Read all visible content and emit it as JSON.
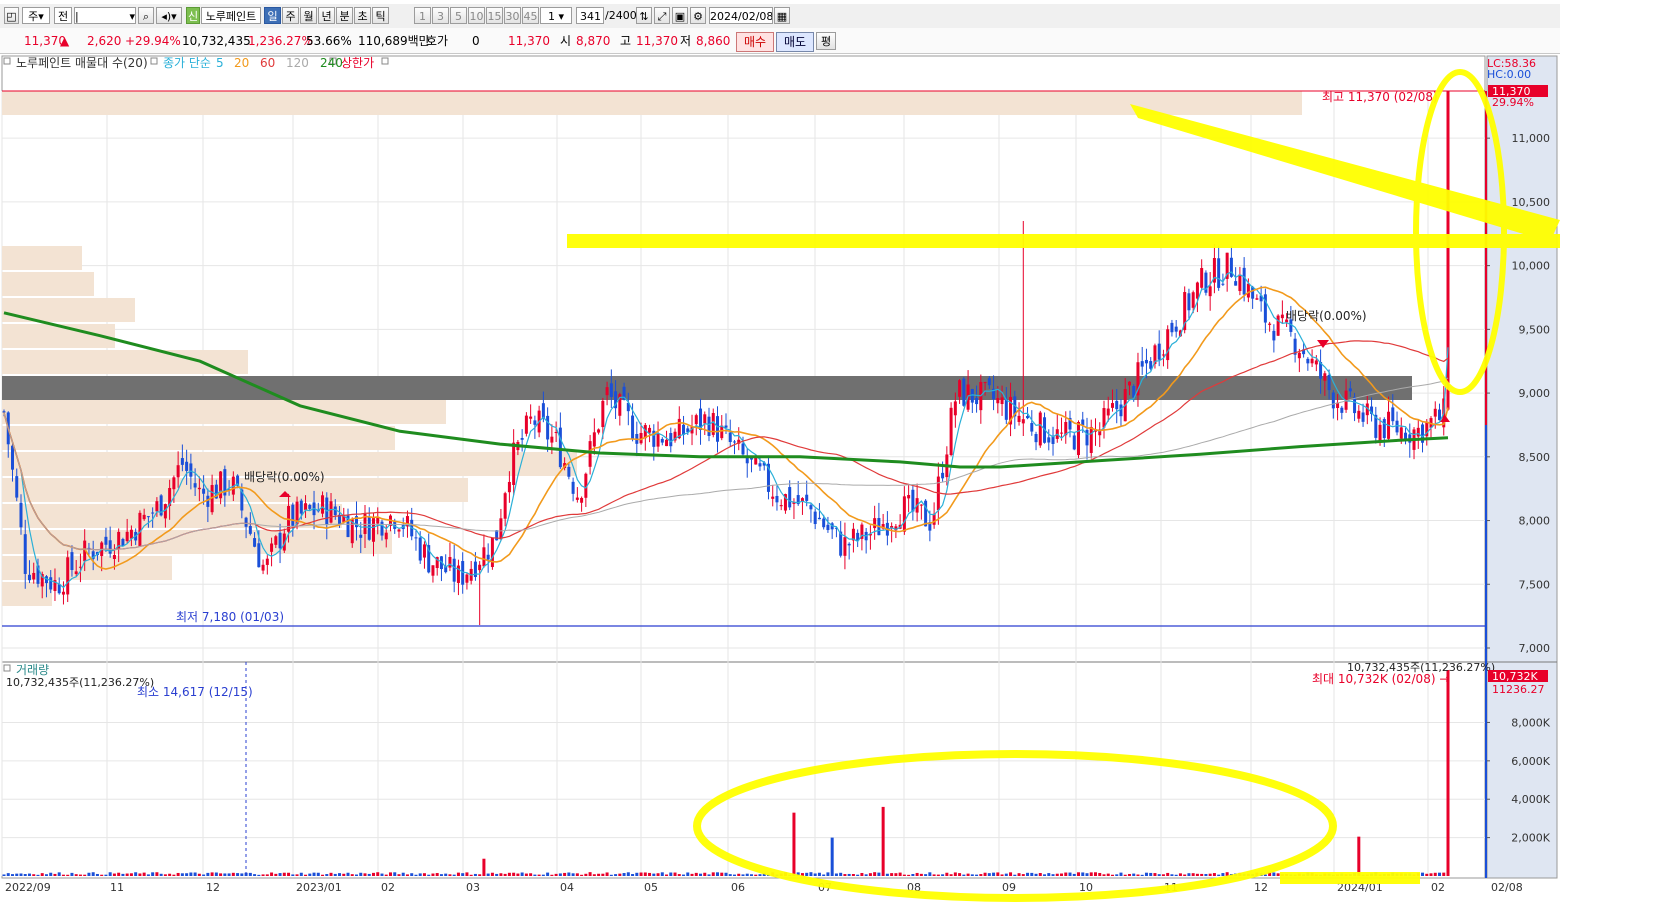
{
  "toolbar": {
    "market_select": "주",
    "scope_select": "전",
    "symbol_badge": "신",
    "stock_name": "노루페인트",
    "periods": [
      "일",
      "주",
      "월",
      "년",
      "분",
      "초",
      "틱"
    ],
    "active_period": "일",
    "intervals": [
      "1",
      "3",
      "5",
      "10",
      "15",
      "30",
      "45",
      "60"
    ],
    "step_value": "1",
    "count": "341",
    "count_total": "/2400",
    "date": "2024/02/08"
  },
  "quote": {
    "price": "11,370",
    "arrow": "▲",
    "change": "2,620",
    "change_rate": "+29.94%",
    "volume": "10,732,435",
    "volume_rate": "1,236.27%",
    "turnover": "53.66%",
    "amount": "110,689백만",
    "hoga_label": "호가",
    "hoga_value": "0",
    "hoga_price": "11,370",
    "open_label": "시",
    "open": "8,870",
    "high_label": "고",
    "high": "11,370",
    "low_label": "저",
    "low": "8,860",
    "buy_label": "매수",
    "sell_label": "매도",
    "avg_label": "평"
  },
  "price_panel": {
    "legend_title": "노루페인트 매물대 수(20)",
    "legend_ma_prefix": "종가 단순",
    "legend_limit": "상한가",
    "lc_label": "LC:58.36",
    "hc_label": "HC:0.00",
    "high_annotation": "최고 11,370 (02/08)",
    "low_annotation": "최저 7,180 (01/03)",
    "dividend_label": "배당락(0.00%)",
    "current_price_tag": "11,370",
    "current_rate_tag": "29.94%"
  },
  "volume_panel": {
    "title": "거래량",
    "current_info": "10,732,435주(11,236.27%)",
    "top_info": "10,732,435주(11,236.27%)",
    "max_annotation": "최대 10,732K (02/08) →",
    "min_annotation": "최소 14,617 (12/15)",
    "tag_value": "10,732K",
    "tag_rate": "11236.27"
  },
  "colors": {
    "up": "#e8002a",
    "down": "#1a4fd8",
    "ma5": "#2ab0d8",
    "ma20": "#f29a1c",
    "ma60": "#e03a3a",
    "ma120": "#aaaaaa",
    "ma240": "#1f8c1f",
    "volume_profile": "#f3e3d3",
    "highlighter": "#ffff00",
    "grey_band": "#707070"
  },
  "chart_data": [
    {
      "type": "candlestick",
      "title": "노루페인트",
      "x_tick_labels": [
        "2022/09",
        "11",
        "12",
        "2023/01",
        "02",
        "03",
        "04",
        "05",
        "06",
        "07",
        "08",
        "09",
        "10",
        "11",
        "12",
        "2024/01",
        "02",
        "02/08"
      ],
      "y_tick_labels": [
        "7,000",
        "7,500",
        "8,000",
        "8,500",
        "9,000",
        "9,500",
        "10,000",
        "10,500",
        "11,000"
      ],
      "ylim": [
        7000,
        11370
      ],
      "ma_periods": [
        5,
        20,
        60,
        120,
        240
      ],
      "series": [
        {
          "name": "종가",
          "points": [
            {
              "x": "2022/09",
              "y": 8800
            },
            {
              "x": "2022/10",
              "y": 7600
            },
            {
              "x": "2022/11",
              "y": 7800
            },
            {
              "x": "2022/12",
              "y": 8250
            },
            {
              "x": "2023/01",
              "y": 7900
            },
            {
              "x": "2023/02",
              "y": 8100
            },
            {
              "x": "2023/03",
              "y": 7700
            },
            {
              "x": "2023/04",
              "y": 7850
            },
            {
              "x": "2023/05",
              "y": 8400
            },
            {
              "x": "2023/06",
              "y": 8550
            },
            {
              "x": "2023/07",
              "y": 8300
            },
            {
              "x": "2023/08",
              "y": 8050
            },
            {
              "x": "2023/09",
              "y": 9050
            },
            {
              "x": "2023/10",
              "y": 8700
            },
            {
              "x": "2023/11",
              "y": 9800
            },
            {
              "x": "2023/12",
              "y": 9350
            },
            {
              "x": "2024/01",
              "y": 8800
            },
            {
              "x": "2024/02",
              "y": 8750
            },
            {
              "x": "2024/02/08",
              "y": 11370
            }
          ]
        }
      ],
      "annotations": [
        {
          "label": "최고",
          "date": "02/08",
          "value": 11370
        },
        {
          "label": "최저",
          "date": "01/03",
          "value": 7180
        }
      ]
    },
    {
      "type": "bar",
      "title": "거래량",
      "y_tick_labels": [
        "2,000K",
        "4,000K",
        "6,000K",
        "8,000K"
      ],
      "ylim": [
        0,
        10732
      ],
      "series": [
        {
          "name": "거래량",
          "points": [
            {
              "x": "2023/01",
              "y": 900
            },
            {
              "x": "2023/04",
              "y": 3300
            },
            {
              "x": "2023/04b",
              "y": 2000
            },
            {
              "x": "2023/05",
              "y": 3600
            },
            {
              "x": "2023/08",
              "y": 2050
            },
            {
              "x": "2024/02/08",
              "y": 10732
            }
          ]
        }
      ],
      "annotations": [
        {
          "label": "최대",
          "date": "02/08",
          "value": "10,732K"
        },
        {
          "label": "최소",
          "date": "12/15",
          "value": "14,617"
        }
      ]
    }
  ]
}
